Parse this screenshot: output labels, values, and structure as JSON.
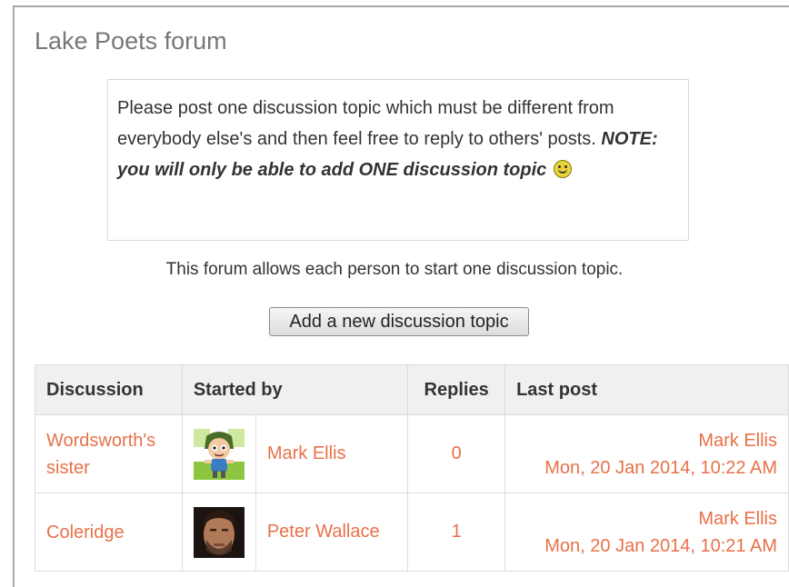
{
  "forum": {
    "title": "Lake Poets forum",
    "intro_text": "Please post one discussion topic which must be different from everybody else's and then feel free to reply to others' posts. ",
    "intro_note": "NOTE: you will only be able to add ONE discussion topic",
    "smiley_icon": "smiley-icon",
    "notice": "This forum allows each person to start one discussion topic.",
    "add_button": "Add a new discussion topic"
  },
  "table": {
    "headers": {
      "discussion": "Discussion",
      "started_by": "Started by",
      "replies": "Replies",
      "last_post": "Last post"
    },
    "rows": [
      {
        "discussion": "Wordsworth's sister",
        "avatar": "cartoon-avatar",
        "started_by": "Mark Ellis",
        "replies": "0",
        "last_post_author": "Mark Ellis",
        "last_post_date": "Mon, 20 Jan 2014, 10:22 AM"
      },
      {
        "discussion": "Coleridge",
        "avatar": "photo-avatar",
        "started_by": "Peter Wallace",
        "replies": "1",
        "last_post_author": "Mark Ellis",
        "last_post_date": "Mon, 20 Jan 2014, 10:21 AM"
      }
    ]
  },
  "colors": {
    "link": "#e8714a",
    "title": "#777777",
    "header_bg": "#f0f0f0"
  }
}
